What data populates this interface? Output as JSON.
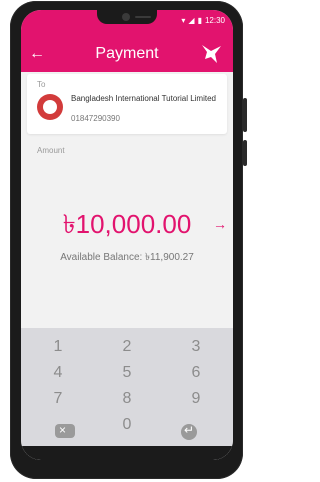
{
  "status": {
    "time": "12:30"
  },
  "header": {
    "title": "Payment",
    "back_icon": "arrow-left-icon",
    "brand_icon": "bird-logo-icon"
  },
  "recipient": {
    "to_label": "To",
    "name": "Bangladesh International Tutorial Limited",
    "number": "01847290390",
    "logo_icon": "institution-seal-icon"
  },
  "amount": {
    "label": "Amount",
    "value": "৳10,000.00",
    "arrow": "→"
  },
  "balance": {
    "text": "Available Balance: ৳11,900.27"
  },
  "keypad": {
    "keys": [
      "1",
      "2",
      "3",
      "4",
      "5",
      "6",
      "7",
      "8",
      "9",
      "0"
    ],
    "backspace_icon": "backspace-icon",
    "enter_icon": "enter-icon"
  },
  "colors": {
    "accent": "#e2136e"
  }
}
